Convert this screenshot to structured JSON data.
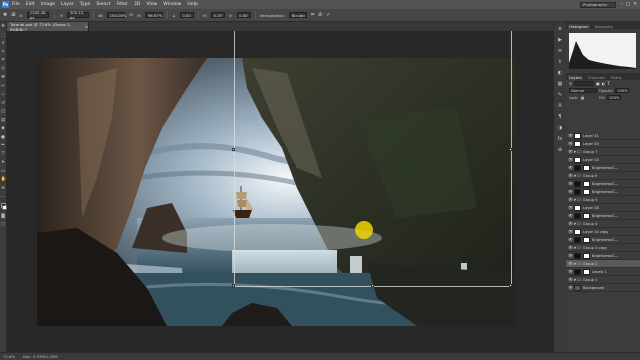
{
  "app": {
    "logo": "Ps",
    "menu": [
      "File",
      "Edit",
      "Image",
      "Layer",
      "Type",
      "Select",
      "Filter",
      "3D",
      "View",
      "Window",
      "Help"
    ],
    "workspace": "Photography",
    "window_controls": [
      "–",
      "□",
      "✕"
    ]
  },
  "options": {
    "x_label": "X:",
    "x_value": "1250.48 px",
    "y_label": "Y:",
    "y_value": "305.15 px",
    "w_label": "W:",
    "w_value": "100.00%",
    "h_label": "H:",
    "h_value": "96.67%",
    "angle_value": "0.00",
    "hskew_label": "H:",
    "hskew_value": "0.29",
    "vskew_label": "V:",
    "vskew_value": "0.00",
    "interp_label": "Interpolation:",
    "interp_value": "Bicubic"
  },
  "document": {
    "tab_title": "Tutorial.psd @ 72.6% (Group 2, RGB/8) *",
    "close": "×"
  },
  "status": {
    "zoom": "72.6%",
    "doc_size": "Doc: 5.93M/1.20M"
  },
  "panels": {
    "tabs_top": [
      "Histogram",
      "Navigator"
    ],
    "tabs_layers": [
      "Layers",
      "Channels",
      "Paths"
    ],
    "blend_mode": "Normal",
    "opacity_label": "Opacity:",
    "opacity_value": "100%",
    "lock_label": "Lock:",
    "fill_label": "Fill:",
    "fill_value": "100%"
  },
  "layers": [
    {
      "name": "Layer 31",
      "type": "layer"
    },
    {
      "name": "Layer 30",
      "type": "layer"
    },
    {
      "name": "Group 7",
      "type": "group"
    },
    {
      "name": "Layer 24",
      "type": "layer"
    },
    {
      "name": "Brightness/C...",
      "type": "adjust"
    },
    {
      "name": "Group 6",
      "type": "group"
    },
    {
      "name": "Brightness/C...",
      "type": "adjust"
    },
    {
      "name": "Brightness/C...",
      "type": "adjust"
    },
    {
      "name": "Group 5",
      "type": "group"
    },
    {
      "name": "Layer 28",
      "type": "layer"
    },
    {
      "name": "Brightness/C...",
      "type": "adjust"
    },
    {
      "name": "Group 4",
      "type": "group"
    },
    {
      "name": "Layer 24 copy",
      "type": "layer"
    },
    {
      "name": "Brightness/C...",
      "type": "adjust"
    },
    {
      "name": "Group 3 copy",
      "type": "group"
    },
    {
      "name": "Brightness/C...",
      "type": "adjust"
    },
    {
      "name": "Group 2",
      "type": "group",
      "selected": true
    },
    {
      "name": "Levels 1",
      "type": "adjust"
    },
    {
      "name": "Group 1",
      "type": "group"
    },
    {
      "name": "Background",
      "type": "background"
    }
  ]
}
